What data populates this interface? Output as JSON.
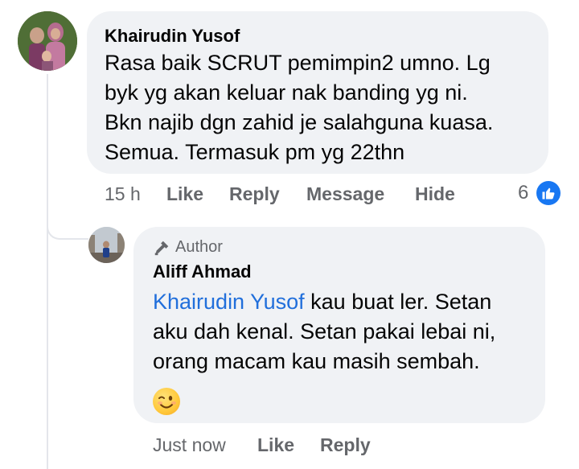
{
  "comments": [
    {
      "author": "Khairudin Yusof",
      "lines": [
        "Rasa baik SCRUT pemimpin2 umno. Lg",
        "byk yg akan keluar nak banding yg ni.",
        "Bkn najib dgn zahid je salahguna kuasa.",
        "Semua. Termasuk pm yg 22thn"
      ],
      "time": "15 h",
      "actions": {
        "like": "Like",
        "reply": "Reply",
        "message": "Message",
        "hide": "Hide"
      },
      "reaction_count": "6",
      "reaction_icon": "thumbs-up-icon"
    }
  ],
  "reply": {
    "badge": "Author",
    "badge_icon": "microphone-icon",
    "author": "Aliff Ahmad",
    "mention": "Khairudin Yusof",
    "line1_rest": " kau buat ler. Setan",
    "line2": "aku dah kenal. Setan pakai lebai ni,",
    "line3": "orang macam kau masih sembah.",
    "emoji": "winking-face-icon",
    "time": "Just now",
    "actions": {
      "like": "Like",
      "reply": "Reply"
    }
  },
  "colors": {
    "bubble": "#f0f2f5",
    "mention": "#216fdb",
    "meta": "#65676b",
    "like_blue": "#1877f2"
  }
}
